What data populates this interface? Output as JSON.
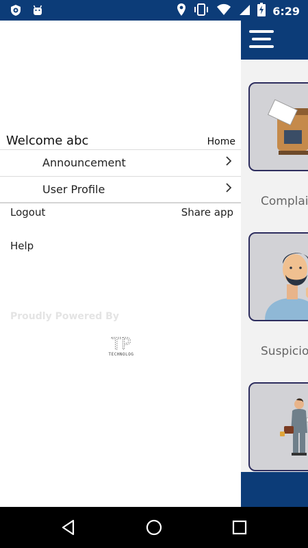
{
  "status_bar": {
    "time": "6:29",
    "icons": [
      "vpn-shield-icon",
      "android-icon",
      "location-icon",
      "vibrate-icon",
      "wifi-icon",
      "signal-icon",
      "battery-charging-icon"
    ]
  },
  "drawer": {
    "welcome_text": "Welcome abc",
    "home_label": "Home",
    "menu_items": [
      {
        "label": "Announcement"
      },
      {
        "label": "User Profile"
      }
    ],
    "logout_label": "Logout",
    "share_label": "Share app",
    "help_label": "Help",
    "powered_by": "Proudly Powered By",
    "logo_text": "TECHNOLOG"
  },
  "background_app": {
    "cards": [
      {
        "label": "Complai"
      },
      {
        "label": "Suspicio"
      }
    ]
  },
  "colors": {
    "primary": "#0c3c78",
    "card_bg": "#d2d2d6",
    "card_border": "#2d2d5e"
  }
}
